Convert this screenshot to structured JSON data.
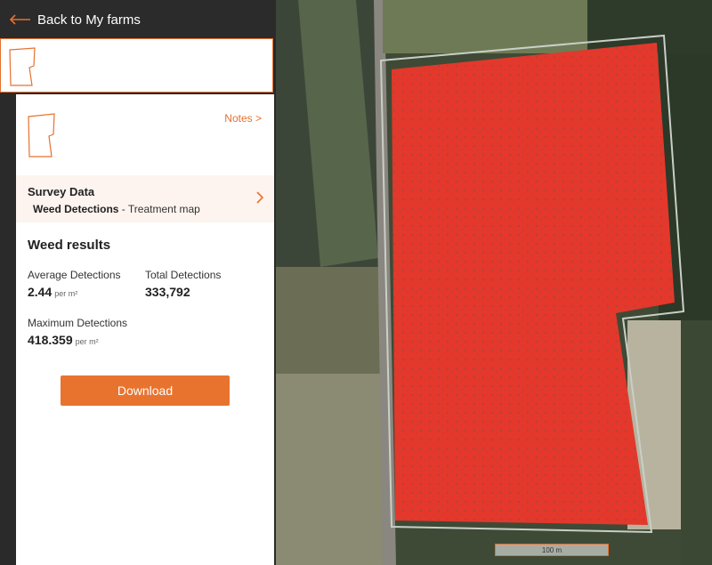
{
  "topbar": {
    "back_label": "Back to My farms"
  },
  "panel": {
    "notes_label": "Notes >",
    "survey": {
      "title": "Survey Data",
      "type_bold": "Weed Detections",
      "type_rest": " - Treatment map"
    },
    "weed_results": {
      "title": "Weed results",
      "average": {
        "label": "Average Detections",
        "value": "2.44",
        "unit": "per m²"
      },
      "total": {
        "label": "Total Detections",
        "value": "333,792"
      },
      "maximum": {
        "label": "Maximum Detections",
        "value": "418.359",
        "unit": "per m²"
      }
    },
    "download_label": "Download"
  },
  "map": {
    "scale_label": "100 m"
  },
  "colors": {
    "accent": "#e6712f",
    "weed": "#e8362a"
  }
}
